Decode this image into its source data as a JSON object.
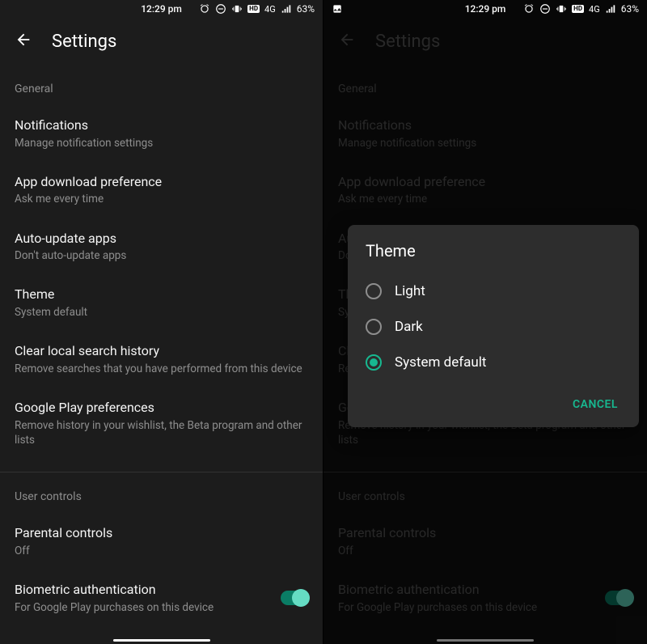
{
  "statusbar": {
    "time": "12:29 pm",
    "network_label": "4G",
    "battery_text": "63%",
    "hd_label": "HD"
  },
  "appbar": {
    "title": "Settings"
  },
  "sections": {
    "general_label": "General",
    "user_controls_label": "User controls"
  },
  "settings": {
    "notifications": {
      "title": "Notifications",
      "desc": "Manage notification settings"
    },
    "download_pref": {
      "title": "App download preference",
      "desc": "Ask me every time"
    },
    "auto_update": {
      "title": "Auto-update apps",
      "desc": "Don't auto-update apps"
    },
    "theme": {
      "title": "Theme",
      "desc": "System default"
    },
    "clear_history": {
      "title": "Clear local search history",
      "desc": "Remove searches that you have performed from this device"
    },
    "play_prefs": {
      "title": "Google Play preferences",
      "desc": "Remove history in your wishlist, the Beta program and other lists"
    },
    "parental": {
      "title": "Parental controls",
      "desc": "Off"
    },
    "biometric": {
      "title": "Biometric authentication",
      "desc": "For Google Play purchases on this device"
    }
  },
  "dialog": {
    "title": "Theme",
    "options": {
      "light": "Light",
      "dark": "Dark",
      "system": "System default"
    },
    "selected": "system",
    "cancel": "CANCEL"
  },
  "accent_color": "#17b890"
}
